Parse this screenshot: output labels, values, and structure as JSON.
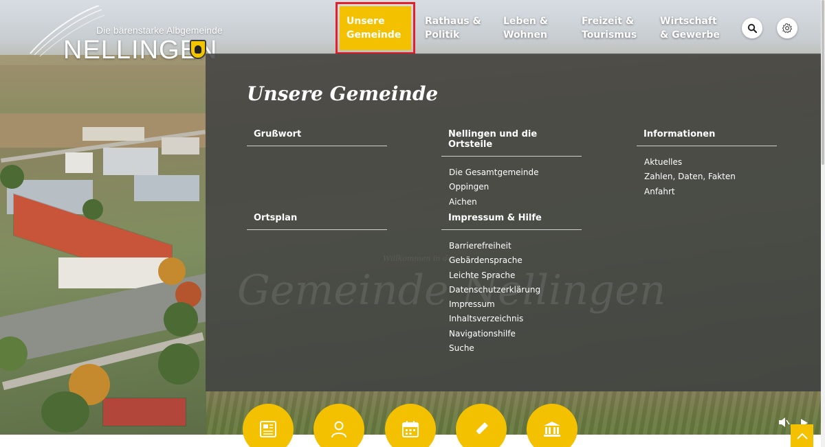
{
  "colors": {
    "accent": "#f3c100",
    "panel": "#424242",
    "highlight_border": "#e2202a",
    "text": "#ffffff"
  },
  "logo": {
    "tagline": "Die bärenstarke Albgemeinde",
    "name": "NELLINGEN",
    "shield_icon": "coat-of-arms-bear"
  },
  "nav": {
    "items": [
      {
        "line1": "Unsere",
        "line2": "Gemeinde",
        "active": true
      },
      {
        "line1": "Rathaus &",
        "line2": "Politik"
      },
      {
        "line1": "Leben &",
        "line2": "Wohnen"
      },
      {
        "line1": "Freizeit &",
        "line2": "Tourismus"
      },
      {
        "line1": "Wirtschaft",
        "line2": "& Gewerbe"
      }
    ],
    "search_icon": "search-icon",
    "settings_icon": "gear-icon"
  },
  "mega_menu": {
    "title": "Unsere Gemeinde",
    "watermark_small": "Willkommen in der",
    "watermark": "Gemeinde Nellingen",
    "groups": [
      {
        "heading": "Grußwort",
        "links": []
      },
      {
        "heading": "Nellingen und die Ortsteile",
        "links": [
          "Die Gesamtgemeinde",
          "Oppingen",
          "Aichen"
        ]
      },
      {
        "heading": "Informationen",
        "links": [
          "Aktuelles",
          "Zahlen, Daten, Fakten",
          "Anfahrt"
        ]
      },
      {
        "heading": "Ortsplan",
        "links": []
      },
      {
        "heading": "Impressum & Hilfe",
        "links": [
          "Barrierefreiheit",
          "Gebärdensprache",
          "Leichte Sprache",
          "Datenschutzerklärung",
          "Impressum",
          "Inhaltsverzeichnis",
          "Navigationshilfe",
          "Suche"
        ]
      }
    ]
  },
  "quick_links": [
    {
      "icon": "newspaper-icon"
    },
    {
      "icon": "user-icon"
    },
    {
      "icon": "calendar-icon"
    },
    {
      "icon": "pencil-icon"
    },
    {
      "icon": "town-hall-icon"
    }
  ],
  "video_controls": {
    "mute_icon": "speaker-icon",
    "play_icon": "play-icon"
  },
  "back_to_top_icon": "chevron-up-icon"
}
